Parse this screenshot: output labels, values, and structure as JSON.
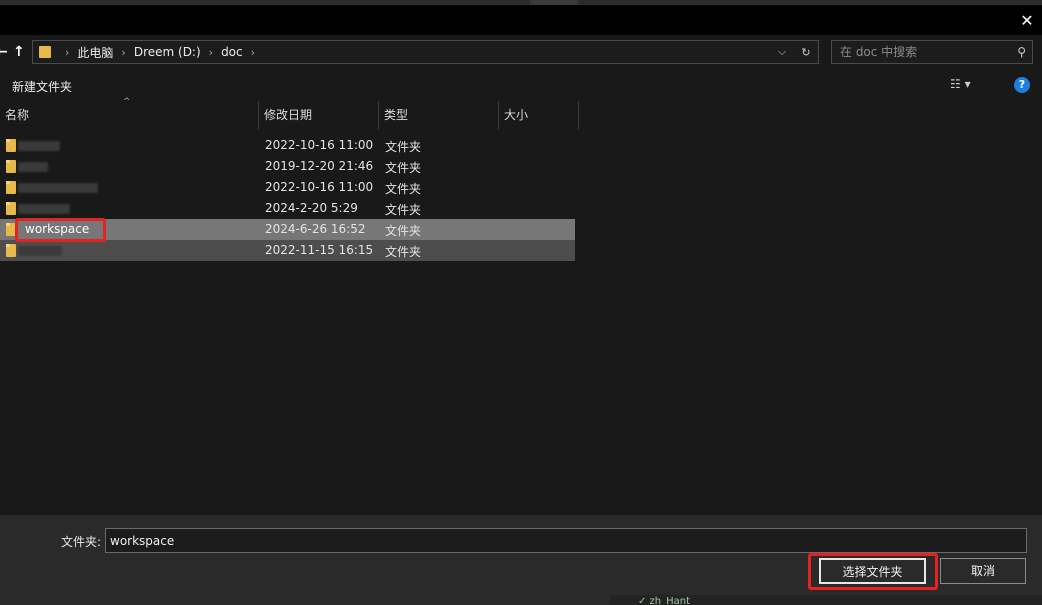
{
  "window": {
    "close_glyph": "✕"
  },
  "nav": {
    "back_glyph": "←",
    "up_glyph": "↑",
    "breadcrumb": [
      "此电脑",
      "Dreem (D:)",
      "doc"
    ],
    "separator": "›",
    "dropdown_glyph": "⌵",
    "refresh_glyph": "↻"
  },
  "search": {
    "placeholder": "在 doc 中搜索",
    "icon_glyph": "⚲"
  },
  "toolbar": {
    "new_folder_label": "新建文件夹",
    "view_glyph": "☷ ▾",
    "help_glyph": "?"
  },
  "columns": {
    "name": "名称",
    "modified": "修改日期",
    "type": "类型",
    "size": "大小",
    "sort_glyph": "^"
  },
  "files": [
    {
      "name": "",
      "modified": "2022-10-16 11:00",
      "type": "文件夹"
    },
    {
      "name": "",
      "modified": "2019-12-20 21:46",
      "type": "文件夹"
    },
    {
      "name": "",
      "modified": "2022-10-16 11:00",
      "type": "文件夹"
    },
    {
      "name": "",
      "modified": "2024-2-20 5:29",
      "type": "文件夹"
    },
    {
      "name": "workspace",
      "modified": "2024-6-26 16:52",
      "type": "文件夹"
    },
    {
      "name": "",
      "modified": "2022-11-15 16:15",
      "type": "文件夹"
    }
  ],
  "footer": {
    "folder_label": "文件夹:",
    "folder_value": "workspace",
    "select_button": "选择文件夹",
    "cancel_button": "取消",
    "background_text": "✓ zh_Hant"
  },
  "colors": {
    "highlight": "#e52222",
    "selected_row": "#777777",
    "folder_icon": "#e6b94a",
    "help_accent": "#1f7de0"
  }
}
